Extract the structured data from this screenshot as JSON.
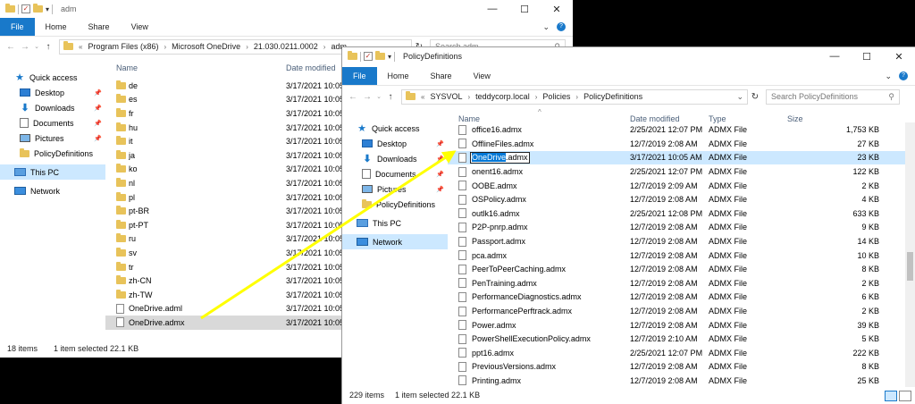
{
  "w1": {
    "title": "adm",
    "tabs": [
      "File",
      "Home",
      "Share",
      "View"
    ],
    "path": [
      "Program Files (x86)",
      "Microsoft OneDrive",
      "21.030.0211.0002",
      "adm"
    ],
    "search_placeholder": "Search adm",
    "columns": {
      "name": "Name",
      "date": "Date modified"
    },
    "nav": [
      {
        "label": "Quick access",
        "icon": "star-icon",
        "pinned": false,
        "selected": false
      },
      {
        "label": "Desktop",
        "icon": "desktop-icon",
        "pinned": true,
        "selected": false
      },
      {
        "label": "Downloads",
        "icon": "downloads-icon",
        "pinned": true,
        "selected": false
      },
      {
        "label": "Documents",
        "icon": "documents-icon",
        "pinned": true,
        "selected": false
      },
      {
        "label": "Pictures",
        "icon": "pictures-icon",
        "pinned": true,
        "selected": false
      },
      {
        "label": "PolicyDefinitions",
        "icon": "folder-icon",
        "pinned": false,
        "selected": false
      },
      {
        "label": "This PC",
        "icon": "pc-icon",
        "pinned": false,
        "selected": true
      },
      {
        "label": "Network",
        "icon": "network-icon",
        "pinned": false,
        "selected": false
      }
    ],
    "files": [
      {
        "name": "de",
        "date": "3/17/2021 10:05",
        "icon": "folder-icon"
      },
      {
        "name": "es",
        "date": "3/17/2021 10:05",
        "icon": "folder-icon"
      },
      {
        "name": "fr",
        "date": "3/17/2021 10:05",
        "icon": "folder-icon"
      },
      {
        "name": "hu",
        "date": "3/17/2021 10:05",
        "icon": "folder-icon"
      },
      {
        "name": "it",
        "date": "3/17/2021 10:05",
        "icon": "folder-icon"
      },
      {
        "name": "ja",
        "date": "3/17/2021 10:05",
        "icon": "folder-icon"
      },
      {
        "name": "ko",
        "date": "3/17/2021 10:05",
        "icon": "folder-icon"
      },
      {
        "name": "nl",
        "date": "3/17/2021 10:05",
        "icon": "folder-icon"
      },
      {
        "name": "pl",
        "date": "3/17/2021 10:05",
        "icon": "folder-icon"
      },
      {
        "name": "pt-BR",
        "date": "3/17/2021 10:05",
        "icon": "folder-icon"
      },
      {
        "name": "pt-PT",
        "date": "3/17/2021 10:05",
        "icon": "folder-icon"
      },
      {
        "name": "ru",
        "date": "3/17/2021 10:05",
        "icon": "folder-icon"
      },
      {
        "name": "sv",
        "date": "3/17/2021 10:05",
        "icon": "folder-icon"
      },
      {
        "name": "tr",
        "date": "3/17/2021 10:05",
        "icon": "folder-icon"
      },
      {
        "name": "zh-CN",
        "date": "3/17/2021 10:05",
        "icon": "folder-icon"
      },
      {
        "name": "zh-TW",
        "date": "3/17/2021 10:05",
        "icon": "folder-icon"
      },
      {
        "name": "OneDrive.adml",
        "date": "3/17/2021 10:05",
        "icon": "file-icon"
      },
      {
        "name": "OneDrive.admx",
        "date": "3/17/2021 10:05",
        "icon": "file-icon",
        "selected": true
      }
    ],
    "status": {
      "count": "18 items",
      "selection": "1 item selected  22.1 KB"
    }
  },
  "w2": {
    "title": "PolicyDefinitions",
    "tabs": [
      "File",
      "Home",
      "Share",
      "View"
    ],
    "path": [
      "SYSVOL",
      "teddycorp.local",
      "Policies",
      "PolicyDefinitions"
    ],
    "search_placeholder": "Search PolicyDefinitions",
    "columns": {
      "name": "Name",
      "date": "Date modified",
      "type": "Type",
      "size": "Size"
    },
    "nav": [
      {
        "label": "Quick access",
        "icon": "star-icon",
        "pinned": false,
        "selected": false
      },
      {
        "label": "Desktop",
        "icon": "desktop-icon",
        "pinned": true,
        "selected": false
      },
      {
        "label": "Downloads",
        "icon": "downloads-icon",
        "pinned": true,
        "selected": false
      },
      {
        "label": "Documents",
        "icon": "documents-icon",
        "pinned": true,
        "selected": false
      },
      {
        "label": "Pictures",
        "icon": "pictures-icon",
        "pinned": true,
        "selected": false
      },
      {
        "label": "PolicyDefinitions",
        "icon": "folder-icon",
        "pinned": false,
        "selected": false
      },
      {
        "label": "This PC",
        "icon": "pc-icon",
        "pinned": false,
        "selected": false
      },
      {
        "label": "Network",
        "icon": "network-icon",
        "pinned": false,
        "selected": true
      }
    ],
    "files": [
      {
        "name": "office16.admx",
        "date": "2/25/2021 12:07 PM",
        "type": "ADMX File",
        "size": "1,753 KB"
      },
      {
        "name": "OfflineFiles.admx",
        "date": "12/7/2019 2:08 AM",
        "type": "ADMX File",
        "size": "27 KB"
      },
      {
        "name": "OneDrive.admx",
        "rename_prefix": "OneDrive",
        "rename_suffix": ".admx",
        "date": "3/17/2021 10:05 AM",
        "type": "ADMX File",
        "size": "23 KB",
        "selected": true
      },
      {
        "name": "onent16.admx",
        "date": "2/25/2021 12:07 PM",
        "type": "ADMX File",
        "size": "122 KB"
      },
      {
        "name": "OOBE.admx",
        "date": "12/7/2019 2:09 AM",
        "type": "ADMX File",
        "size": "2 KB"
      },
      {
        "name": "OSPolicy.admx",
        "date": "12/7/2019 2:08 AM",
        "type": "ADMX File",
        "size": "4 KB"
      },
      {
        "name": "outlk16.admx",
        "date": "2/25/2021 12:08 PM",
        "type": "ADMX File",
        "size": "633 KB"
      },
      {
        "name": "P2P-pnrp.admx",
        "date": "12/7/2019 2:08 AM",
        "type": "ADMX File",
        "size": "9 KB"
      },
      {
        "name": "Passport.admx",
        "date": "12/7/2019 2:08 AM",
        "type": "ADMX File",
        "size": "14 KB"
      },
      {
        "name": "pca.admx",
        "date": "12/7/2019 2:08 AM",
        "type": "ADMX File",
        "size": "10 KB"
      },
      {
        "name": "PeerToPeerCaching.admx",
        "date": "12/7/2019 2:08 AM",
        "type": "ADMX File",
        "size": "8 KB"
      },
      {
        "name": "PenTraining.admx",
        "date": "12/7/2019 2:08 AM",
        "type": "ADMX File",
        "size": "2 KB"
      },
      {
        "name": "PerformanceDiagnostics.admx",
        "date": "12/7/2019 2:08 AM",
        "type": "ADMX File",
        "size": "6 KB"
      },
      {
        "name": "PerformancePerftrack.admx",
        "date": "12/7/2019 2:08 AM",
        "type": "ADMX File",
        "size": "2 KB"
      },
      {
        "name": "Power.admx",
        "date": "12/7/2019 2:08 AM",
        "type": "ADMX File",
        "size": "39 KB"
      },
      {
        "name": "PowerShellExecutionPolicy.admx",
        "date": "12/7/2019 2:10 AM",
        "type": "ADMX File",
        "size": "5 KB"
      },
      {
        "name": "ppt16.admx",
        "date": "2/25/2021 12:07 PM",
        "type": "ADMX File",
        "size": "222 KB"
      },
      {
        "name": "PreviousVersions.admx",
        "date": "12/7/2019 2:08 AM",
        "type": "ADMX File",
        "size": "8 KB"
      },
      {
        "name": "Printing.admx",
        "date": "12/7/2019 2:08 AM",
        "type": "ADMX File",
        "size": "25 KB"
      }
    ],
    "status": {
      "count": "229 items",
      "selection": "1 item selected  22.1 KB"
    }
  },
  "annotation": {
    "arrow_color": "#ffff00"
  }
}
